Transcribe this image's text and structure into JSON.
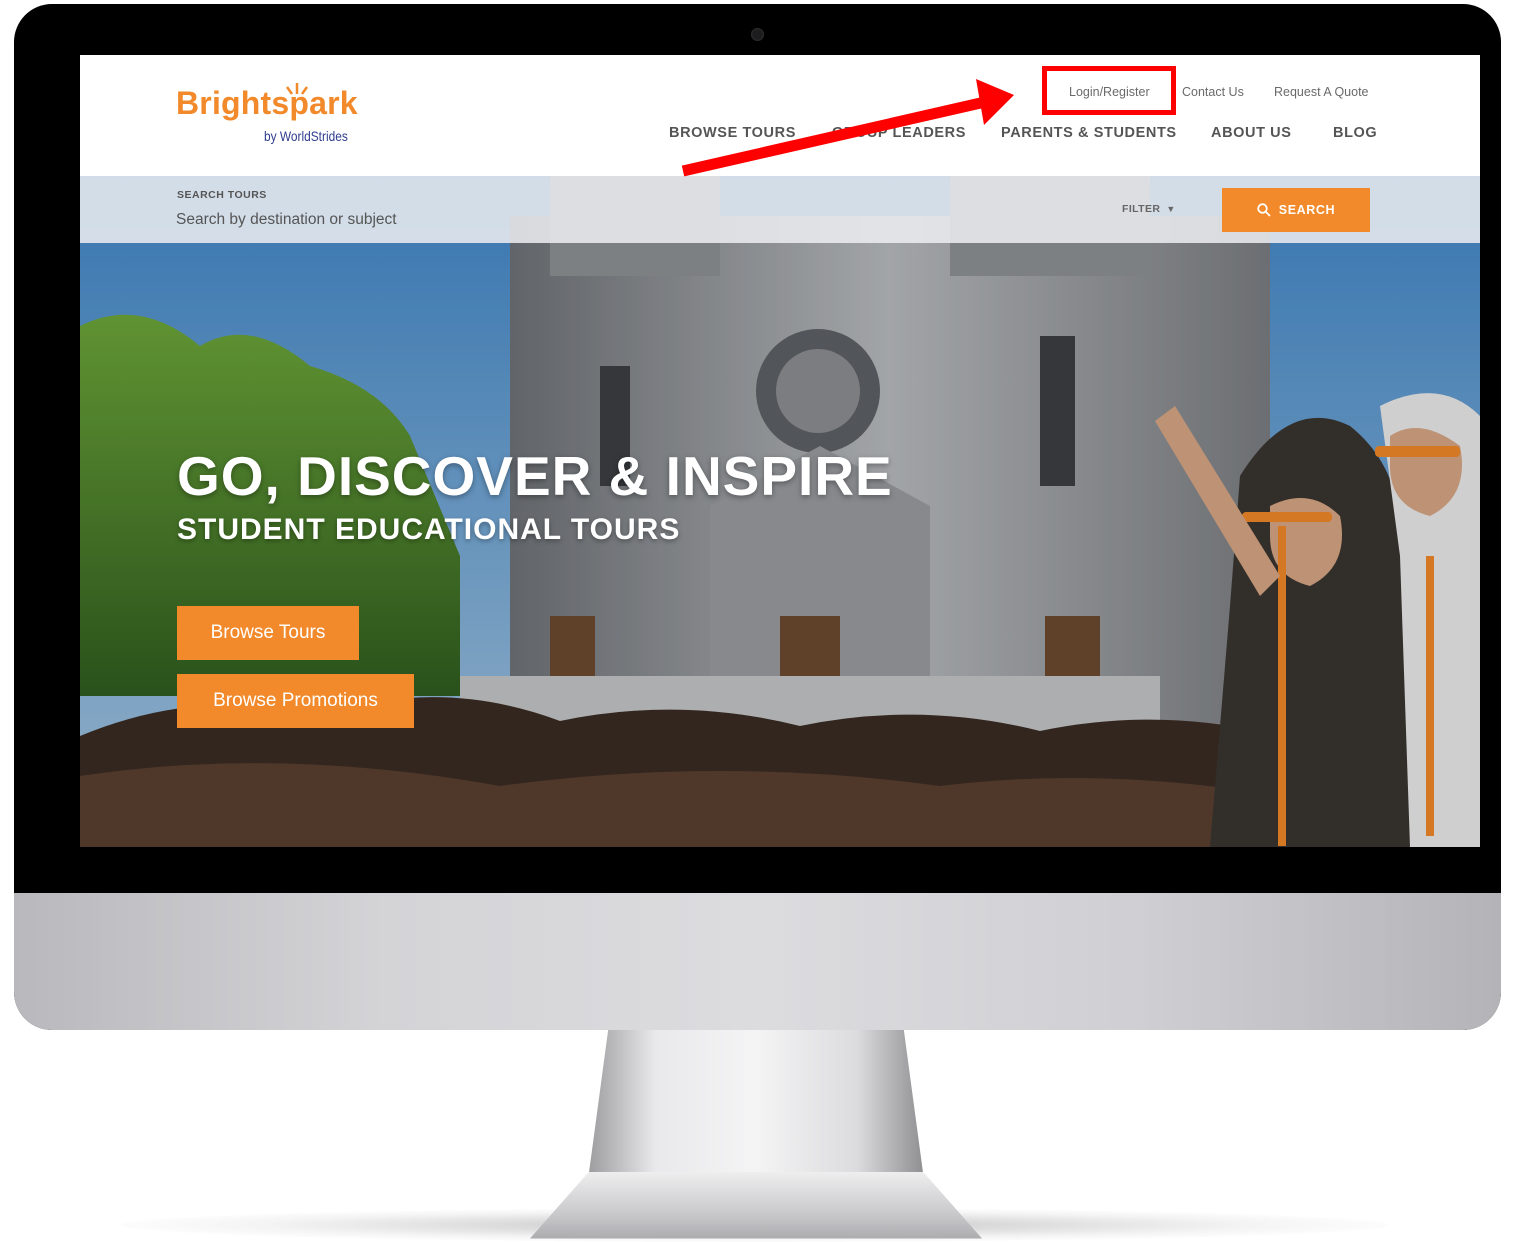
{
  "brand": {
    "name": "Brightspark",
    "tagline": "by WorldStrides",
    "accent_color": "#f2892a",
    "tagline_color": "#2f3e8f"
  },
  "utility_nav": [
    "Login/Register",
    "Contact Us",
    "Request A Quote"
  ],
  "main_nav": [
    "BROWSE TOURS",
    "GROUP LEADERS",
    "PARENTS & STUDENTS",
    "ABOUT US",
    "BLOG"
  ],
  "search": {
    "label": "SEARCH TOURS",
    "placeholder": "Search by destination or subject",
    "filter_label": "FILTER",
    "button_label": "SEARCH",
    "button_icon": "search-icon"
  },
  "hero": {
    "title": "GO, DISCOVER & INSPIRE",
    "subtitle": "STUDENT EDUCATIONAL TOURS",
    "buttons": [
      "Browse Tours",
      "Browse Promotions"
    ],
    "background": "cathedral-with-students-photo"
  },
  "annotation": {
    "highlight_color": "#ff0000",
    "highlighted_item": "Login/Register",
    "arrow_icon": "red-arrow-icon"
  }
}
